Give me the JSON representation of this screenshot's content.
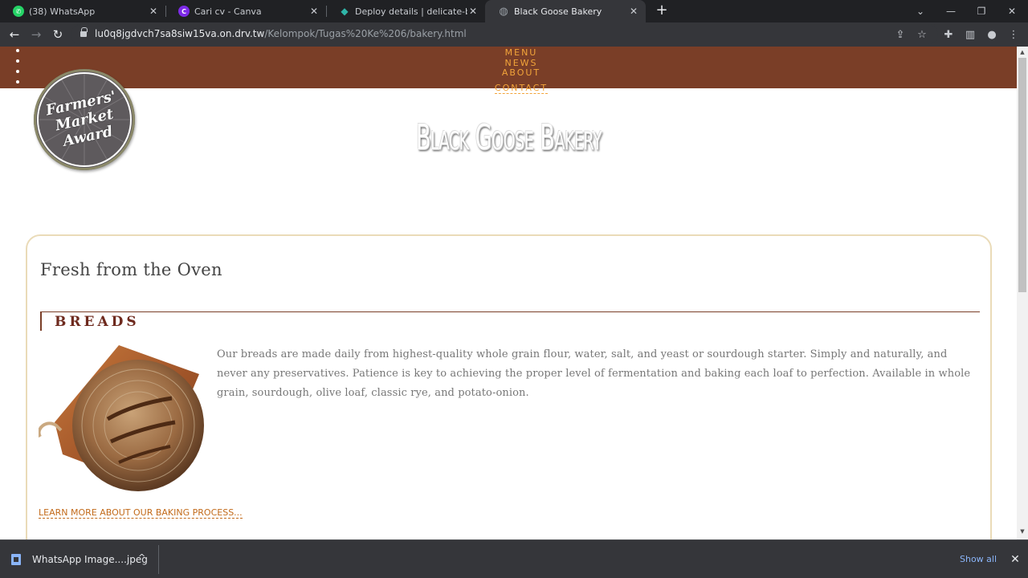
{
  "browser": {
    "tabs": [
      {
        "title": "(38) WhatsApp",
        "icon": "whatsapp-icon",
        "color": "#25d366",
        "glyph": "✆"
      },
      {
        "title": "Cari cv - Canva",
        "icon": "canva-icon",
        "color": "#7d2ae8",
        "glyph": "C"
      },
      {
        "title": "Deploy details | delicate-brigade",
        "icon": "netlify-icon",
        "color": "#2fb5a8",
        "glyph": "◆"
      },
      {
        "title": "Black Goose Bakery",
        "icon": "globe-icon",
        "color": "#9aa0a6",
        "glyph": "◍"
      }
    ],
    "url_host": "lu0q8jgdvch7sa8siw15va.on.drv.tw",
    "url_path": "/Kelompok/Tugas%20Ke%206/bakery.html"
  },
  "site": {
    "nav": [
      "MENU",
      "NEWS",
      "ABOUT",
      "CONTACT"
    ],
    "award": {
      "line1": "Farmers'",
      "line2": "Market",
      "line3": "Award"
    },
    "logo": "Black Goose Bakery",
    "card_title": "Fresh from the Oven",
    "section": "BREADS",
    "bread_description": "Our breads are made daily from highest-quality whole grain flour, water, salt, and yeast or sourdough starter. Simply and naturally, and never any preservatives. Patience is key to achieving the proper level of fermentation and baking each loaf to perfection. Available in whole grain, sourdough, olive loaf, classic rye, and potato-onion.",
    "learn_more": "LEARN MORE ABOUT OUR BAKING PROCESS..."
  },
  "downloads": {
    "file": "WhatsApp Image....jpeg",
    "show_all": "Show all"
  },
  "colors": {
    "nav_bg": "#7a3e27",
    "nav_link": "#f2a43a",
    "section_text": "#6e2a1e",
    "link": "#c26a1a",
    "card_border": "#eadbb8"
  }
}
